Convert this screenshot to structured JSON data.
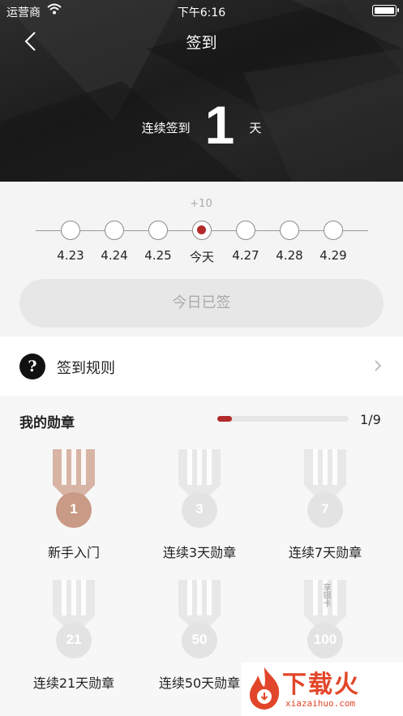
{
  "status": {
    "carrier": "运营商",
    "time": "下午6:16"
  },
  "nav": {
    "title": "签到"
  },
  "streak": {
    "label": "连续签到",
    "days": "1",
    "unit": "天"
  },
  "timeline": {
    "bonus": "+10",
    "days": [
      "4.23",
      "4.24",
      "4.25",
      "今天",
      "4.27",
      "4.28",
      "4.29"
    ],
    "today_index": 3
  },
  "sign_button": {
    "label": "今日已签"
  },
  "rules": {
    "label": "签到规则",
    "icon_glyph": "?"
  },
  "medals": {
    "title": "我的勋章",
    "progress_text": "1/9",
    "progress_fraction": 0.11,
    "items": [
      {
        "number": "1",
        "label": "新手入门",
        "earned": true
      },
      {
        "number": "3",
        "label": "连续3天勋章",
        "earned": false
      },
      {
        "number": "7",
        "label": "连续7天勋章",
        "earned": false
      },
      {
        "number": "21",
        "label": "连续21天勋章",
        "earned": false
      },
      {
        "number": "50",
        "label": "连续50天勋章",
        "earned": false
      },
      {
        "number": "100",
        "label": "",
        "earned": false,
        "ribbon_text": "享银卡"
      }
    ]
  },
  "watermark": {
    "title": "下载火",
    "url": "xiazaihuo.com"
  },
  "colors": {
    "accent": "#b22a2a",
    "earned_medal": "#c99a86",
    "locked_medal": "#e3e3e3",
    "watermark": "#e2462a"
  }
}
